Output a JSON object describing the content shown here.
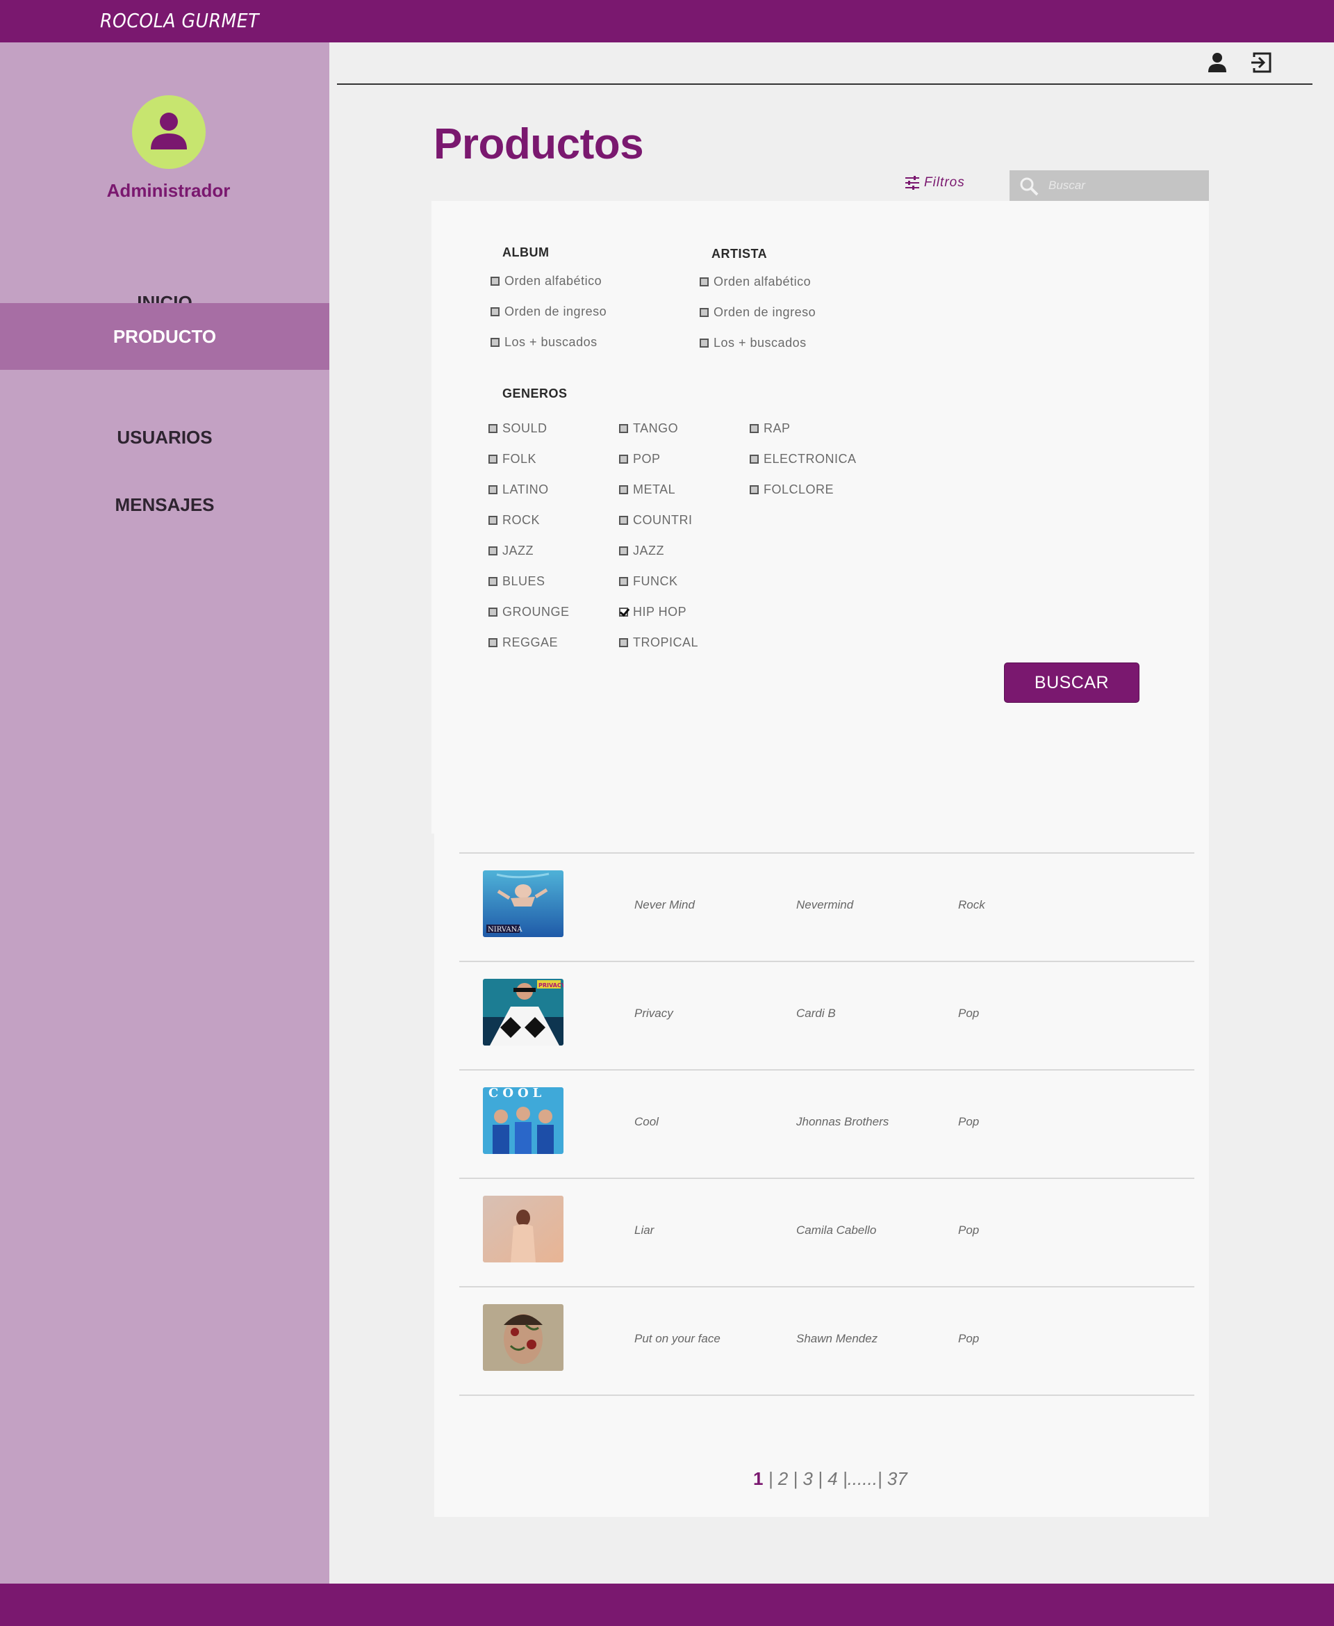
{
  "app": {
    "brand": "ROCOLA GURMET"
  },
  "sidebar": {
    "user_name": "Administrador",
    "items": [
      {
        "label": "INICIO",
        "active": false
      },
      {
        "label": "PRODUCTO",
        "active": true
      },
      {
        "label": "USUARIOS",
        "active": false
      },
      {
        "label": "MENSAJES",
        "active": false
      }
    ]
  },
  "header": {
    "icons": [
      "user-icon",
      "logout-icon"
    ]
  },
  "main": {
    "title": "Productos",
    "filters_label": "Filtros",
    "search_placeholder": "Buscar",
    "filter_panel": {
      "album": {
        "title": "ALBUM",
        "options": [
          {
            "label": "Orden alfabético",
            "checked": false
          },
          {
            "label": "Orden de ingreso",
            "checked": false
          },
          {
            "label": "Los + buscados",
            "checked": false
          }
        ]
      },
      "artista": {
        "title": "ARTISTA",
        "options": [
          {
            "label": "Orden alfabético",
            "checked": false
          },
          {
            "label": "Orden de ingreso",
            "checked": false
          },
          {
            "label": "Los + buscados",
            "checked": false
          }
        ]
      },
      "generos": {
        "title": "GENEROS",
        "col1": [
          {
            "label": "SOULD",
            "checked": false
          },
          {
            "label": "FOLK",
            "checked": false
          },
          {
            "label": "LATINO",
            "checked": false
          },
          {
            "label": "ROCK",
            "checked": false
          },
          {
            "label": "JAZZ",
            "checked": false
          },
          {
            "label": "BLUES",
            "checked": false
          },
          {
            "label": "GROUNGE",
            "checked": false
          },
          {
            "label": "REGGAE",
            "checked": false
          }
        ],
        "col2": [
          {
            "label": "TANGO",
            "checked": false
          },
          {
            "label": "POP",
            "checked": false
          },
          {
            "label": "METAL",
            "checked": false
          },
          {
            "label": "COUNTRI",
            "checked": false
          },
          {
            "label": "JAZZ",
            "checked": false
          },
          {
            "label": "FUNCK",
            "checked": false
          },
          {
            "label": "HIP HOP",
            "checked": true
          },
          {
            "label": "TROPICAL",
            "checked": false
          }
        ],
        "col3": [
          {
            "label": "RAP",
            "checked": false
          },
          {
            "label": "ELECTRONICA",
            "checked": false
          },
          {
            "label": "FOLCLORE",
            "checked": false
          }
        ]
      },
      "search_button": "BUSCAR"
    },
    "products": [
      {
        "album": "Never Mind",
        "artist": "Nevermind",
        "genre": "Rock",
        "cover": "nirvana-nevermind-cover"
      },
      {
        "album": "Privacy",
        "artist": "Cardi B",
        "genre": "Pop",
        "cover": "cardi-b-privacy-cover"
      },
      {
        "album": "Cool",
        "artist": "Jhonnas Brothers",
        "genre": "Pop",
        "cover": "jonas-brothers-cool-cover"
      },
      {
        "album": "Liar",
        "artist": "Camila Cabello",
        "genre": "Pop",
        "cover": "camila-cabello-liar-cover"
      },
      {
        "album": "Put on your face",
        "artist": "Shawn Mendez",
        "genre": "Pop",
        "cover": "shawn-mendes-cover"
      }
    ],
    "pagination": {
      "current": "1",
      "pages": [
        "2",
        "3",
        "4"
      ],
      "ellipsis": "......",
      "last": "37",
      "separator": "|"
    }
  },
  "colors": {
    "brand": "#7a186f",
    "sidebar": "#c3a1c3",
    "sidebar_active": "#a76ea4",
    "avatar": "#c7e56f",
    "search_bg": "#c4c4c4"
  }
}
